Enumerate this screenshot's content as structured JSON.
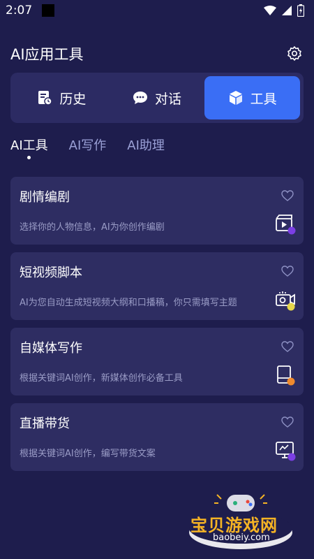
{
  "status_bar": {
    "time": "2:07",
    "icons": [
      "wifi-icon",
      "signal-icon",
      "battery-icon"
    ]
  },
  "header": {
    "title": "AI应用工具",
    "settings_icon": "gear-icon"
  },
  "segments": [
    {
      "label": "历史",
      "icon": "history-doc-icon",
      "active": false
    },
    {
      "label": "对话",
      "icon": "chat-bubble-icon",
      "active": false
    },
    {
      "label": "工具",
      "icon": "cube-icon",
      "active": true
    }
  ],
  "subtabs": [
    {
      "label": "AI工具",
      "active": true
    },
    {
      "label": "AI写作",
      "active": false
    },
    {
      "label": "AI助理",
      "active": false
    }
  ],
  "cards": [
    {
      "title": "剧情编剧",
      "desc": "选择你的人物信息，AI为你创作编剧",
      "icon": "video-clapper-icon",
      "badge_color": "#7b3fe4"
    },
    {
      "title": "短视频脚本",
      "desc": "AI为您自动生成短视频大纲和口播稿，你只需填写主题",
      "icon": "camera-icon",
      "badge_color": "#e6d64a"
    },
    {
      "title": "自媒体写作",
      "desc": "根据关键词AI创作，新媒体创作必备工具",
      "icon": "tablet-icon",
      "badge_color": "#f08a2e"
    },
    {
      "title": "直播带货",
      "desc": "根据关键词AI创作，编写带货文案",
      "icon": "monitor-icon",
      "badge_color": "#7b3fe4"
    }
  ],
  "watermark": {
    "title": "宝贝游戏网",
    "url": "baobeiy.com"
  },
  "colors": {
    "background": "#1e1d4d",
    "card": "#2e2d62",
    "accent": "#3a6ef5",
    "muted_text": "#9a9cc6"
  }
}
